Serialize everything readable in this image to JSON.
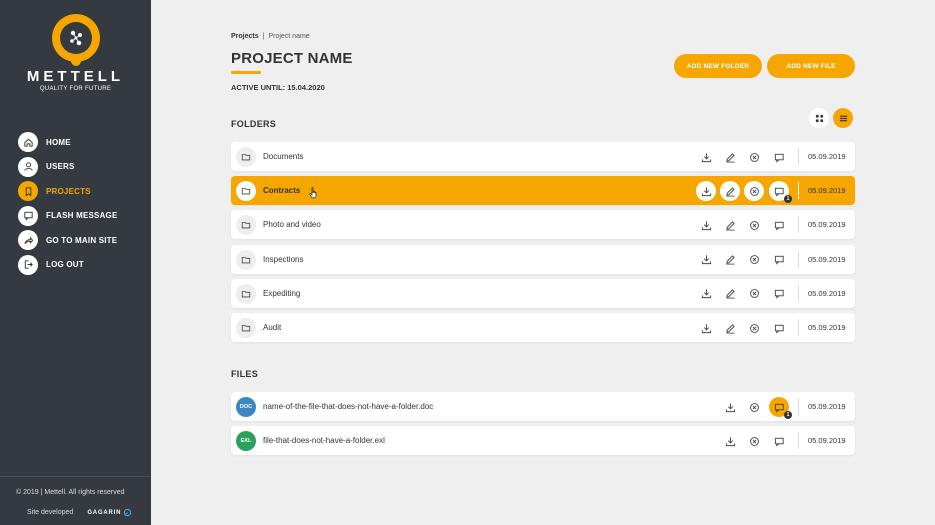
{
  "brand": {
    "name": "METTELL",
    "tagline": "QUALITY FOR FUTURE"
  },
  "nav": [
    {
      "label": "HOME",
      "icon": "home-icon",
      "active": false
    },
    {
      "label": "USERS",
      "icon": "user-icon",
      "active": false
    },
    {
      "label": "PROJECTS",
      "icon": "bookmark-icon",
      "active": true
    },
    {
      "label": "FLASH MESSAGE",
      "icon": "message-icon",
      "active": false
    },
    {
      "label": "GO TO MAIN SITE",
      "icon": "share-icon",
      "active": false
    },
    {
      "label": "LOG OUT",
      "icon": "logout-icon",
      "active": false
    }
  ],
  "footer": {
    "copyright": "© 2019   |   Mettell. All rights reserved",
    "developed": "Site developed",
    "dev_logo": "GAGARIN"
  },
  "breadcrumb": {
    "first": "Projects",
    "sep": "|",
    "current": "Project name"
  },
  "page": {
    "title": "PROJECT NAME",
    "active_until": "ACTIVE UNTIL: 15.04.2020"
  },
  "buttons": {
    "add_folder": "ADD NEW FOLDER",
    "add_file": "ADD NEW FILE"
  },
  "sections": {
    "folders": "FOLDERS",
    "files": "FILES"
  },
  "folders": [
    {
      "name": "Documents",
      "date": "05.09.2019",
      "highlighted": false
    },
    {
      "name": "Contracts",
      "date": "05.09.2019",
      "highlighted": true,
      "message_count": "1"
    },
    {
      "name": "Photo and video",
      "date": "05.09.2019",
      "highlighted": false
    },
    {
      "name": "Inspections",
      "date": "05.09.2019",
      "highlighted": false
    },
    {
      "name": "Expediting",
      "date": "05.09.2019",
      "highlighted": false
    },
    {
      "name": "Audit",
      "date": "05.09.2019",
      "highlighted": false
    }
  ],
  "files": [
    {
      "type": "DOC",
      "name": "name-of-the-file-that-does-not-have-a-folder.doc",
      "date": "05.09.2019",
      "message_count": "1"
    },
    {
      "type": "EXL",
      "name": "file-that-does-not-have-a-folder.exl",
      "date": "05.09.2019"
    }
  ],
  "colors": {
    "accent": "#f5a700",
    "sidebar": "#343a40",
    "background": "#efefef",
    "doc": "#3d86c6",
    "exl": "#2ea05e"
  }
}
